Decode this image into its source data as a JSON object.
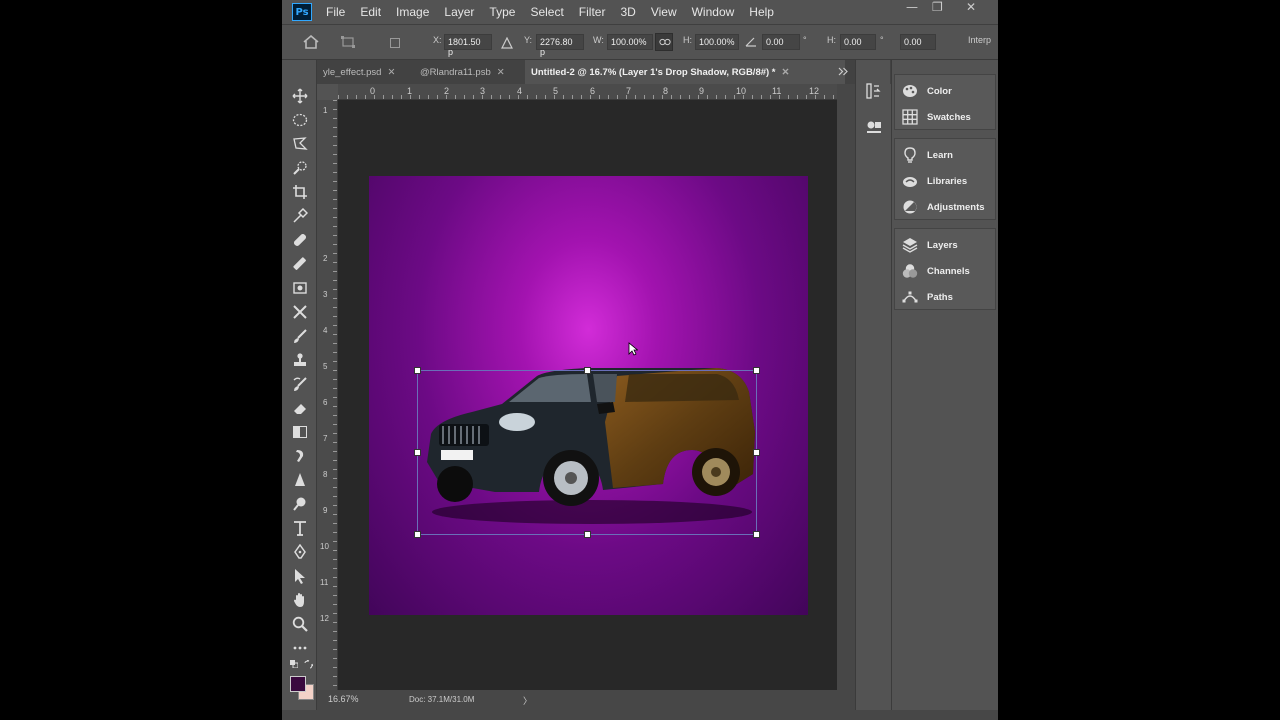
{
  "menubar": {
    "logo": "Ps",
    "items": [
      "File",
      "Edit",
      "Image",
      "Layer",
      "Type",
      "Select",
      "Filter",
      "3D",
      "View",
      "Window",
      "Help"
    ],
    "window_controls": [
      "—",
      "❐",
      "✕"
    ]
  },
  "options": {
    "x_label": "X:",
    "x_value": "1801.50 p",
    "y_label": "Y:",
    "y_value": "2276.80 p",
    "w_label": "W:",
    "w_value": "100.00%",
    "h_label": "H:",
    "h_value": "100.00%",
    "angle_value": "0.00",
    "h_skew_label": "H:",
    "h_skew_value": "0.00",
    "v_skew_value": "0.00",
    "deg1": "°",
    "deg2": "°",
    "interp": "Interp"
  },
  "tabs": [
    {
      "label": "yle_effect.psd",
      "close": "✕"
    },
    {
      "label": "@Rlandra11.psb",
      "close": "✕"
    },
    {
      "label": "Untitled-2 @ 16.7% (Layer 1's Drop Shadow, RGB/8#) *",
      "close": "✕"
    }
  ],
  "ruler": {
    "top": [
      "0",
      "1",
      "2",
      "3",
      "4",
      "5",
      "6",
      "7",
      "8",
      "9",
      "10",
      "11",
      "12"
    ],
    "left": [
      "1",
      "2",
      "3",
      "4",
      "5",
      "6",
      "7",
      "8",
      "9",
      "10",
      "11",
      "12"
    ]
  },
  "status": {
    "zoom": "16.67%",
    "doc": "Doc: 37.1M/31.0M",
    "arrow": "〉"
  },
  "panels": {
    "group1": [
      "Color",
      "Swatches"
    ],
    "group2": [
      "Learn",
      "Libraries",
      "Adjustments"
    ],
    "group3": [
      "Layers",
      "Channels",
      "Paths"
    ]
  },
  "colors": {
    "foreground": "#3a0a3e",
    "background": "#f3d2c8",
    "accent": "#31a8ff"
  }
}
